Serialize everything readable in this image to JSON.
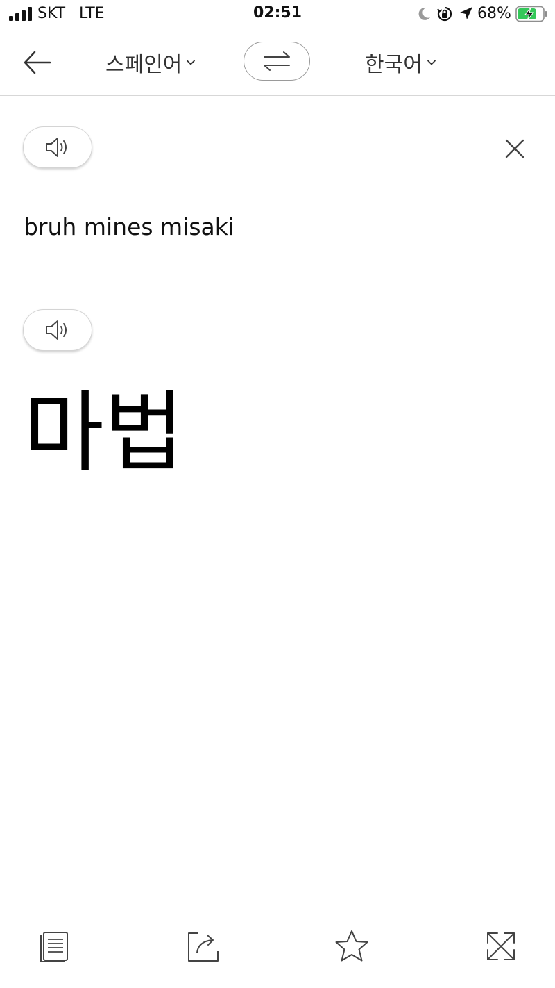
{
  "status_bar": {
    "carrier": "SKT",
    "network": "LTE",
    "time": "02:51",
    "battery_percent": "68%",
    "icons": [
      "signal-icon",
      "moon-icon",
      "orientation-lock-icon",
      "location-arrow-icon",
      "battery-charging-icon"
    ]
  },
  "nav": {
    "source_language": "스페인어",
    "target_language": "한국어",
    "icons": [
      "back-arrow-icon",
      "swap-arrows-icon",
      "chevron-down-icon"
    ]
  },
  "input": {
    "text": "bruh mines misaki",
    "icons": [
      "speaker-icon",
      "close-icon"
    ]
  },
  "output": {
    "text": "마법",
    "icons": [
      "speaker-icon"
    ]
  },
  "toolbar": {
    "icons": [
      "copy-icon",
      "share-icon",
      "star-icon",
      "fullscreen-icon"
    ]
  },
  "colors": {
    "background": "#ffffff",
    "text": "#111111",
    "divider": "#d7d7d7",
    "battery_fill": "#34c759"
  }
}
